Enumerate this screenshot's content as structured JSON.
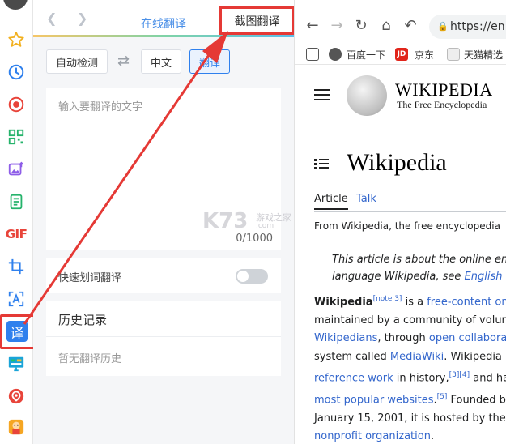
{
  "panel": {
    "tab_online": "在线翻译",
    "tab_screenshot": "截图翻译",
    "source_lang": "自动检测",
    "target_lang": "中文",
    "translate_btn": "翻译",
    "input_placeholder": "输入要翻译的文字",
    "char_count": "0/1000",
    "quick_label": "快速划词翻译",
    "history_title": "历史记录",
    "history_empty": "暂无翻译历史"
  },
  "rail": {
    "gif_label": "GIF",
    "yi_label": "译"
  },
  "browser": {
    "url": "https://en.w",
    "bookmarks": [
      "百度一下",
      "京东",
      "天猫精选"
    ],
    "jd_badge": "JD"
  },
  "wiki": {
    "wordmark": "WIKIPEDIA",
    "tagline": "The Free Encyclopedia",
    "title": "Wikipedia",
    "tab_article": "Article",
    "tab_talk": "Talk",
    "from": "From Wikipedia, the free encyclopedia",
    "hat1": "This article is about the online ency",
    "hat2a": "language Wikipedia, see ",
    "hat2b": "English W",
    "p_l1a": "Wikipedia",
    "p_l1sup": "[note 3]",
    "p_l1b": " is a ",
    "p_l1c": "free-content onlin",
    "p_l2": "maintained by a community of voluntee",
    "p_l3a": "Wikipedians",
    "p_l3b": ", through ",
    "p_l3c": "open collaboratio",
    "p_l4a": "system called ",
    "p_l4b": "MediaWiki",
    "p_l4c": ". Wikipedia is",
    "p_l5a": "reference work",
    "p_l5b": " in history,",
    "p_l5sup": "[3][4]",
    "p_l5c": " and has",
    "p_l6a": "most popular websites",
    "p_l6b": ".",
    "p_l6sup": "[5]",
    "p_l6c": " Founded by",
    "p_l7a": "January 15, 2001, it is hosted by the ",
    "p_l7b": "W",
    "p_l8": "nonprofit organization",
    "p_l8b": "."
  },
  "watermark": {
    "logo": "K73",
    "line1": "游戏之家",
    "line2": ".com"
  }
}
